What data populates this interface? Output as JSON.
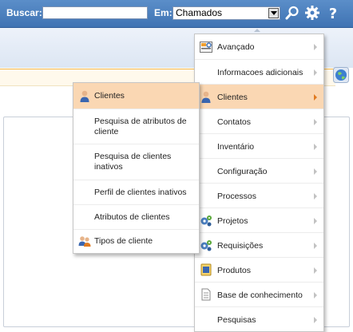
{
  "topbar": {
    "search_label": "Buscar:",
    "search_value": "",
    "scope_label": "Em:",
    "scope_value": "Chamados"
  },
  "icons": {
    "search": "magnifier-icon",
    "settings": "gear-icon",
    "help": "question-mark-icon",
    "globe": "globe-icon"
  },
  "main_menu": {
    "items": [
      {
        "label": "Avançado",
        "icon": "advanced-search-icon",
        "has_submenu": true
      },
      {
        "label": "Informacoes adicionais",
        "icon": "",
        "has_submenu": true
      },
      {
        "label": "Clientes",
        "icon": "user-icon",
        "has_submenu": true,
        "active": true
      },
      {
        "label": "Contatos",
        "icon": "",
        "has_submenu": true
      },
      {
        "label": "Inventário",
        "icon": "",
        "has_submenu": true
      },
      {
        "label": "Configuração",
        "icon": "",
        "has_submenu": true
      },
      {
        "label": "Processos",
        "icon": "",
        "has_submenu": true
      },
      {
        "label": "Projetos",
        "icon": "gears-icon",
        "has_submenu": true
      },
      {
        "label": "Requisições",
        "icon": "gears-icon",
        "has_submenu": true
      },
      {
        "label": "Produtos",
        "icon": "product-icon",
        "has_submenu": true
      },
      {
        "label": "Base de conhecimento",
        "icon": "document-icon",
        "has_submenu": true
      },
      {
        "label": "Pesquisas",
        "icon": "",
        "has_submenu": true
      }
    ]
  },
  "sub_menu": {
    "items": [
      {
        "label": "Clientes",
        "icon": "user-icon",
        "active": true
      },
      {
        "label": "Pesquisa de atributos de cliente",
        "icon": ""
      },
      {
        "label": "Pesquisa de clientes inativos",
        "icon": ""
      },
      {
        "label": "Perfil de clientes inativos",
        "icon": ""
      },
      {
        "label": "Atributos de clientes",
        "icon": ""
      },
      {
        "label": "Tipos de cliente",
        "icon": "users-icon"
      }
    ]
  },
  "colors": {
    "topbar": "#4a7fc0",
    "highlight": "#fad7b3",
    "active_arrow": "#e07a20"
  }
}
